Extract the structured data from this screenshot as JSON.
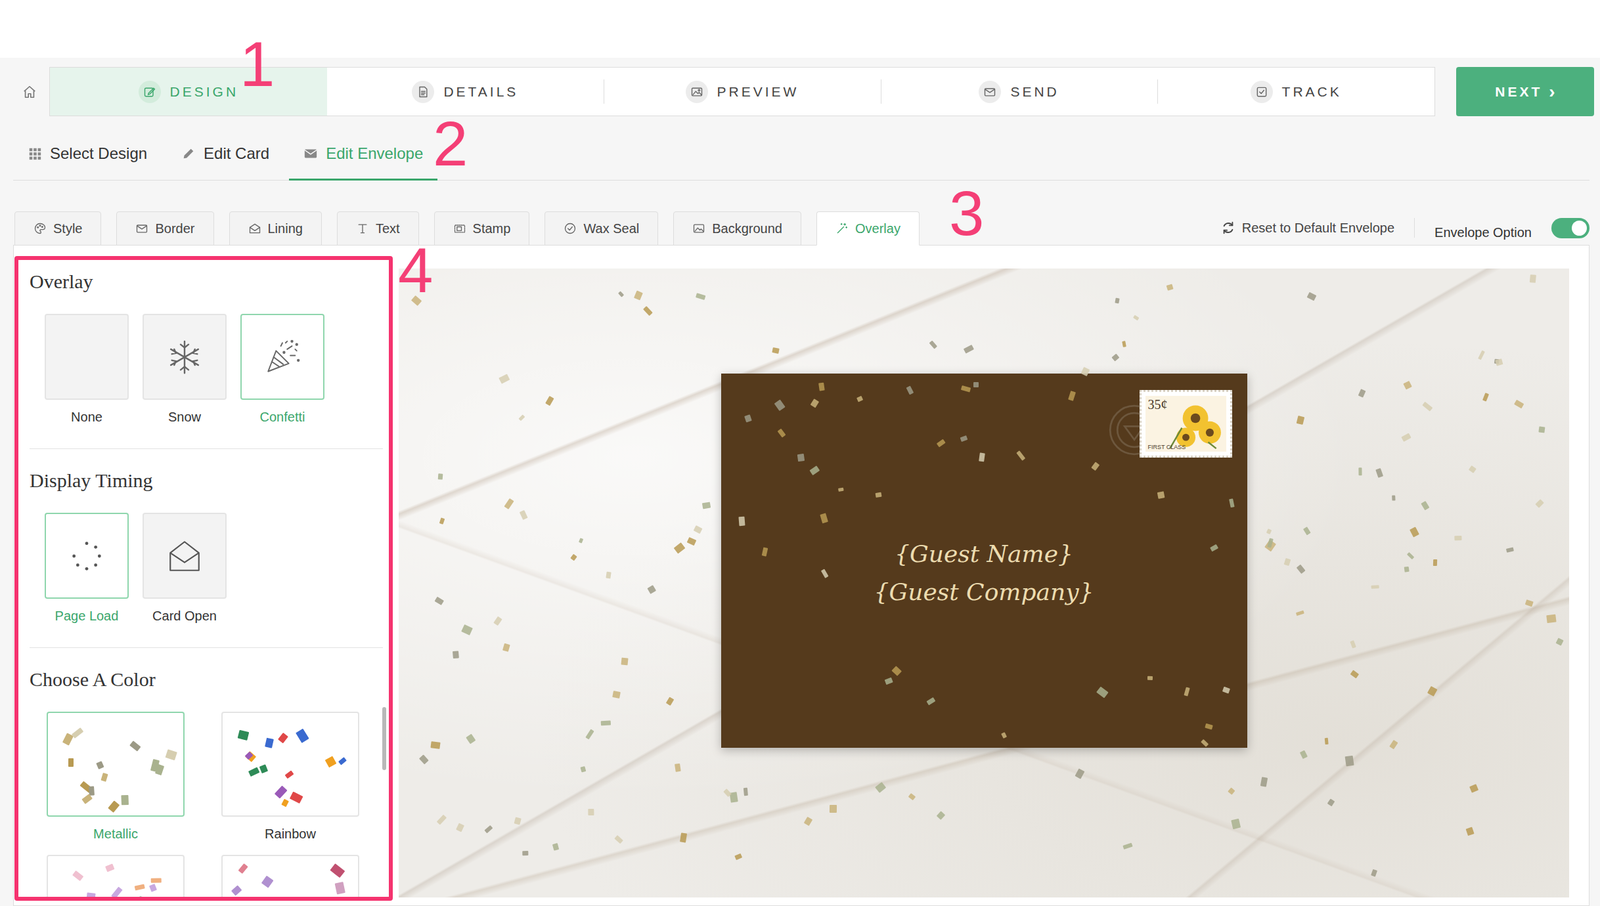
{
  "annotations": [
    "1",
    "2",
    "3",
    "4"
  ],
  "nav": {
    "tabs": [
      {
        "label": "DESIGN",
        "selected": true
      },
      {
        "label": "DETAILS",
        "selected": false
      },
      {
        "label": "PREVIEW",
        "selected": false
      },
      {
        "label": "SEND",
        "selected": false
      },
      {
        "label": "TRACK",
        "selected": false
      }
    ],
    "next": "NEXT",
    "next_icon": "›"
  },
  "subnav": [
    {
      "label": "Select Design",
      "selected": false
    },
    {
      "label": "Edit Card",
      "selected": false
    },
    {
      "label": "Edit Envelope",
      "selected": true
    }
  ],
  "envelope_tabs": [
    {
      "label": "Style",
      "selected": false
    },
    {
      "label": "Border",
      "selected": false
    },
    {
      "label": "Lining",
      "selected": false
    },
    {
      "label": "Text",
      "selected": false
    },
    {
      "label": "Stamp",
      "selected": false
    },
    {
      "label": "Wax Seal",
      "selected": false
    },
    {
      "label": "Background",
      "selected": false
    },
    {
      "label": "Overlay",
      "selected": true
    }
  ],
  "toolbar": {
    "reset": "Reset to Default Envelope",
    "option": {
      "label": "Envelope Option",
      "on": true
    }
  },
  "panel": {
    "overlay": {
      "title": "Overlay",
      "options": [
        {
          "label": "None",
          "kind": "none",
          "selected": false
        },
        {
          "label": "Snow",
          "kind": "snow",
          "selected": false
        },
        {
          "label": "Confetti",
          "kind": "confetti",
          "selected": true
        }
      ]
    },
    "timing": {
      "title": "Display Timing",
      "options": [
        {
          "label": "Page Load",
          "kind": "pageload",
          "selected": true
        },
        {
          "label": "Card Open",
          "kind": "cardopen",
          "selected": false
        }
      ]
    },
    "colors": {
      "title": "Choose A Color",
      "options": [
        {
          "label": "Metallic",
          "selected": true,
          "palette": [
            "#b89a52",
            "#9c9a86",
            "#c9b37a",
            "#a9b28e",
            "#d6ceb0"
          ]
        },
        {
          "label": "Rainbow",
          "selected": false,
          "palette": [
            "#2e8b57",
            "#e04848",
            "#f0a020",
            "#3a6ad0",
            "#9a5ab8"
          ]
        },
        {
          "selected": false,
          "palette": [
            "#c8a8e0",
            "#f0b080",
            "#a0d0b0",
            "#f0c0d0"
          ]
        },
        {
          "selected": false,
          "palette": [
            "#b090d0",
            "#e08090",
            "#d0a0c0",
            "#c05070"
          ]
        }
      ]
    }
  },
  "envelope": {
    "lines": [
      "{Guest Name}",
      "{Guest Company}"
    ],
    "stamp": {
      "value": "35¢",
      "class": "FIRST CLASS"
    }
  }
}
